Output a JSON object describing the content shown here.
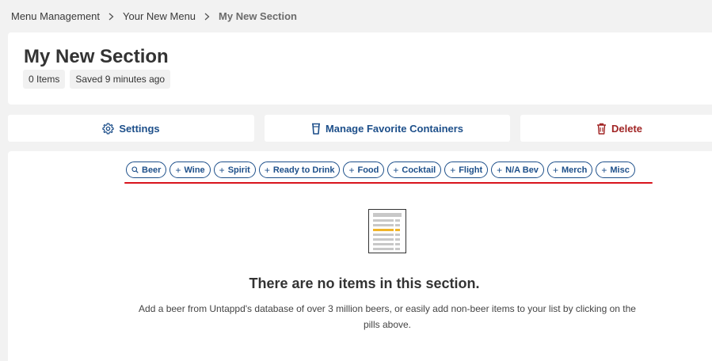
{
  "breadcrumb": [
    {
      "label": "Menu Management"
    },
    {
      "label": "Your New Menu"
    },
    {
      "label": "My New Section"
    }
  ],
  "header": {
    "title": "My New Section",
    "item_count": "0 Items",
    "saved": "Saved 9 minutes ago"
  },
  "actions": {
    "settings": "Settings",
    "containers": "Manage Favorite Containers",
    "delete": "Delete"
  },
  "pills": [
    {
      "label": "Beer",
      "icon": "search-icon"
    },
    {
      "label": "Wine",
      "icon": "plus-icon"
    },
    {
      "label": "Spirit",
      "icon": "plus-icon"
    },
    {
      "label": "Ready to Drink",
      "icon": "plus-icon"
    },
    {
      "label": "Food",
      "icon": "plus-icon"
    },
    {
      "label": "Cocktail",
      "icon": "plus-icon"
    },
    {
      "label": "Flight",
      "icon": "plus-icon"
    },
    {
      "label": "N/A Bev",
      "icon": "plus-icon"
    },
    {
      "label": "Merch",
      "icon": "plus-icon"
    },
    {
      "label": "Misc",
      "icon": "plus-icon"
    }
  ],
  "empty_state": {
    "icon": "document-list-icon",
    "title": "There are no items in this section.",
    "description": "Add a beer from Untappd's database of over 3 million beers, or easily add non-beer items to your list by clicking on the pills above."
  },
  "colors": {
    "accent_blue": "#1d4f8a",
    "delete_red": "#a12525",
    "annotation_red": "#d8141c",
    "highlight_yellow": "#f0b428"
  }
}
